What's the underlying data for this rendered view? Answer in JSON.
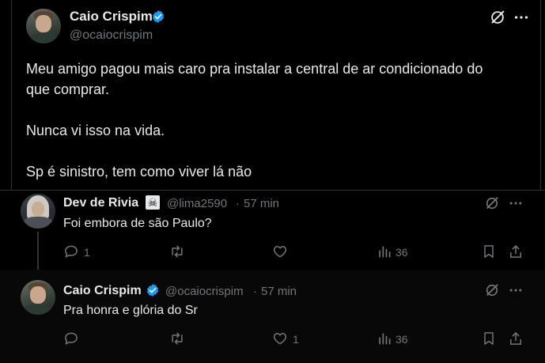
{
  "main_tweet": {
    "author_name": "Caio Crispim",
    "handle": "@ocaiocrispim",
    "lines": [
      "Meu amigo pagou mais caro pra instalar a central de ar condicionado do",
      "que comprar.",
      "Nunca vi isso na vida.",
      "Sp é sinistro, tem como viver lá não"
    ]
  },
  "reply1": {
    "author_name": "Dev de Rivia",
    "emoji": "☠",
    "handle": "@lima2590",
    "separator": "·",
    "time": "57 min",
    "text": "Foi embora de são Paulo?",
    "reply_count": "1",
    "like_count": "",
    "view_count": "36"
  },
  "reply2": {
    "author_name": "Caio Crispim",
    "handle": "@ocaiocrispim",
    "separator": "·",
    "time": "57 min",
    "text": "Pra honra e glória do Sr",
    "reply_count": "",
    "like_count": "1",
    "view_count": "36"
  },
  "colors": {
    "background": "#000000",
    "text": "#e7e9ea",
    "muted": "#71767b",
    "verified": "#1d9bf0",
    "divider": "#2f3336"
  },
  "icons": [
    "verified-badge-icon",
    "grok-icon",
    "more-icon",
    "reply-icon",
    "retweet-icon",
    "like-icon",
    "views-icon",
    "bookmark-icon",
    "share-icon"
  ]
}
